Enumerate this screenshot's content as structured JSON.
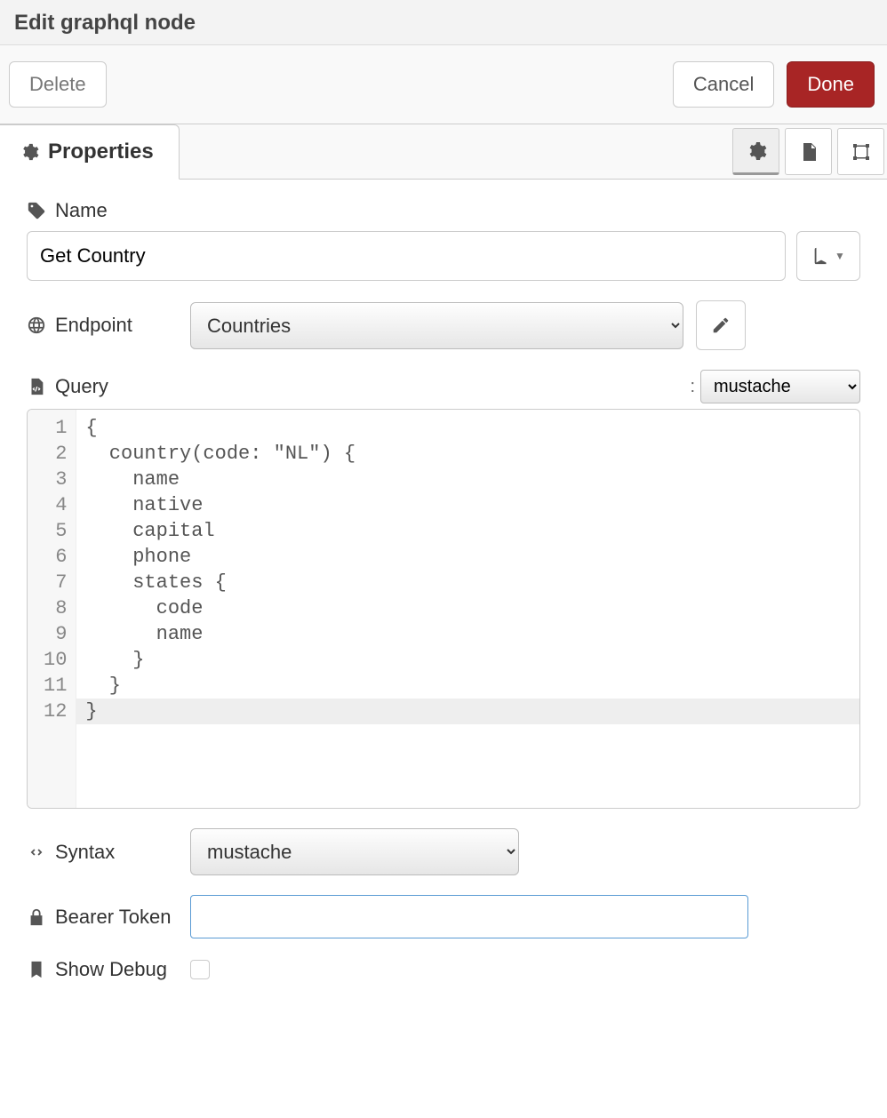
{
  "header": {
    "title": "Edit graphql node"
  },
  "buttons": {
    "delete": "Delete",
    "cancel": "Cancel",
    "done": "Done"
  },
  "tabs": {
    "properties_label": "Properties"
  },
  "fields": {
    "name": {
      "label": "Name",
      "value": "Get Country"
    },
    "endpoint": {
      "label": "Endpoint",
      "value": "Countries"
    },
    "query": {
      "label": "Query",
      "template_select": "mustache",
      "lines": [
        "{",
        "  country(code: \"NL\") {",
        "    name",
        "    native",
        "    capital",
        "    phone",
        "    states {",
        "      code",
        "      name",
        "    }",
        "  }",
        "}"
      ]
    },
    "syntax": {
      "label": "Syntax",
      "value": "mustache"
    },
    "bearer_token": {
      "label": "Bearer Token",
      "value": ""
    },
    "show_debug": {
      "label": "Show Debug",
      "checked": false
    }
  }
}
